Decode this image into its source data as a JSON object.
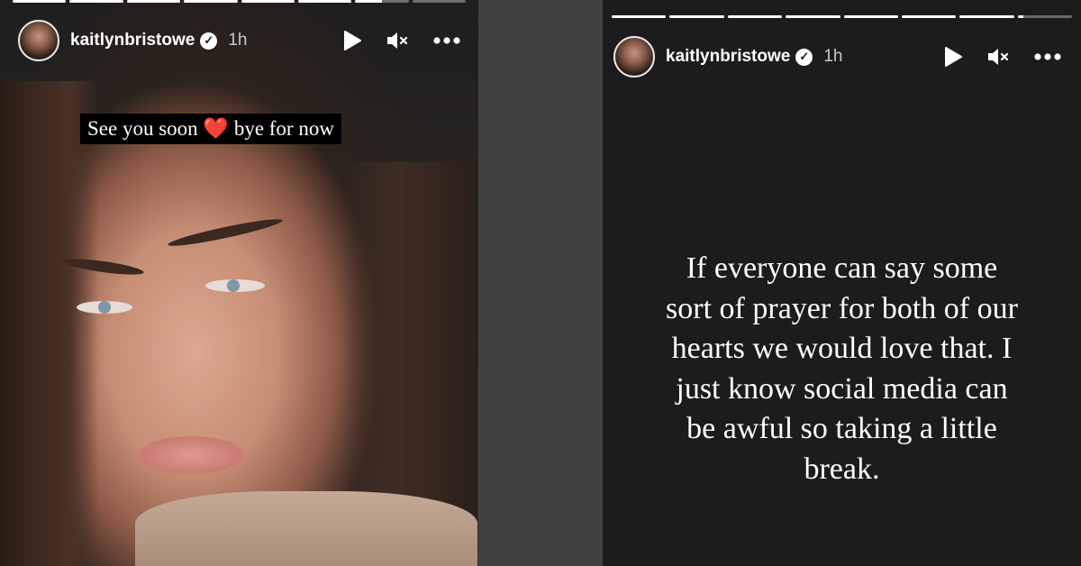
{
  "left_story": {
    "progress_segments": 8,
    "progress_completed": 6.5,
    "header": {
      "username": "kaitlynbristowe",
      "time": "1h",
      "icons": [
        "play-icon",
        "mute-icon",
        "more-icon"
      ]
    },
    "caption": {
      "text_before": "See you soon",
      "emoji": "❤️",
      "text_after": "bye for now"
    }
  },
  "right_story": {
    "progress_segments": 8,
    "progress_completed": 7.1,
    "header": {
      "username": "kaitlynbristowe",
      "time": "1h",
      "icons": [
        "play-icon",
        "mute-icon",
        "more-icon"
      ]
    },
    "text_lines": [
      "If everyone can say some",
      "sort of prayer for both of our",
      "hearts we would love that. I",
      "just know social media can",
      "be awful so taking a little",
      "break."
    ]
  },
  "colors": {
    "page_background": "#414141",
    "story_dark_background": "#1c1b1e",
    "caption_background": "#000000",
    "heart": "#e0202a"
  }
}
